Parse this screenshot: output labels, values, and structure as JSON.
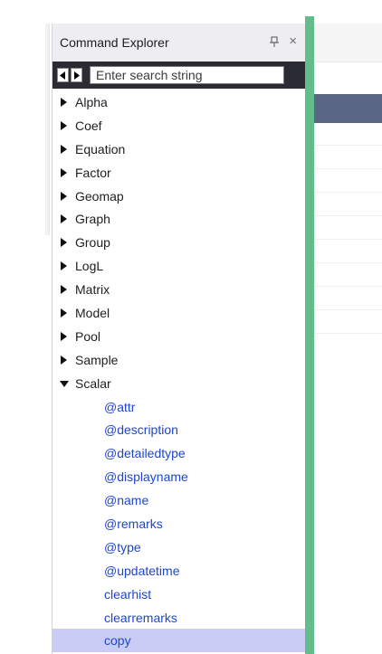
{
  "panel": {
    "title": "Command Explorer",
    "pin_glyph": "ᴩ8",
    "close_glyph": "×"
  },
  "search": {
    "placeholder": "Enter search string",
    "value": ""
  },
  "tree": {
    "collapsed": [
      "Alpha",
      "Coef",
      "Equation",
      "Factor",
      "Geomap",
      "Graph",
      "Group",
      "LogL",
      "Matrix",
      "Model",
      "Pool",
      "Sample"
    ],
    "expanded": {
      "label": "Scalar",
      "children": [
        "@attr",
        "@description",
        "@detailedtype",
        "@displayname",
        "@name",
        "@remarks",
        "@type",
        "@updatetime",
        "clearhist",
        "clearremarks",
        "copy"
      ],
      "selected": "copy"
    }
  },
  "colors": {
    "link": "#1f45ce",
    "selection": "#c9cdf5",
    "accent_rail": "#63bd8b",
    "search_bar": "#2b2b33"
  }
}
